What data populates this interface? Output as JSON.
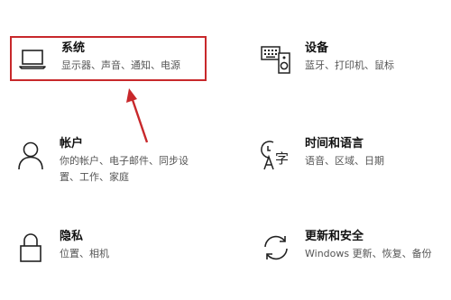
{
  "tiles": {
    "system": {
      "title": "系统",
      "desc": "显示器、声音、通知、电源",
      "icon": "laptop-icon"
    },
    "devices": {
      "title": "设备",
      "desc": "蓝牙、打印机、鼠标",
      "icon": "keyboard-speaker-icon"
    },
    "accounts": {
      "title": "帐户",
      "desc_line1": "你的帐户、电子邮件、同步设",
      "desc_line2": "置、工作、家庭",
      "icon": "person-icon"
    },
    "time": {
      "title": "时间和语言",
      "desc": "语音、区域、日期",
      "icon": "time-language-icon"
    },
    "privacy": {
      "title": "隐私",
      "desc": "位置、相机",
      "icon": "lock-icon"
    },
    "update": {
      "title": "更新和安全",
      "desc": "Windows 更新、恢复、备份",
      "icon": "sync-icon"
    }
  },
  "annotation": {
    "highlight_color": "#c8282b",
    "arrow_color": "#c8282b"
  }
}
